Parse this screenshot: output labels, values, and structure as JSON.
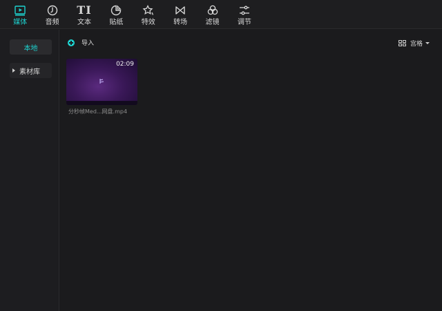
{
  "toolbar": {
    "tabs": [
      {
        "label": "媒体",
        "icon": "media-icon",
        "active": true
      },
      {
        "label": "音频",
        "icon": "audio-icon",
        "active": false
      },
      {
        "label": "文本",
        "icon": "text-icon",
        "active": false
      },
      {
        "label": "贴纸",
        "icon": "sticker-icon",
        "active": false
      },
      {
        "label": "特效",
        "icon": "effects-icon",
        "active": false
      },
      {
        "label": "转场",
        "icon": "transition-icon",
        "active": false
      },
      {
        "label": "滤镜",
        "icon": "filter-icon",
        "active": false
      },
      {
        "label": "调节",
        "icon": "adjust-icon",
        "active": false
      }
    ],
    "text_icon_glyph": "TI"
  },
  "sidebar": {
    "local": "本地",
    "library": "素材库"
  },
  "main": {
    "import_label": "导入",
    "view_label": "宫格"
  },
  "media_items": [
    {
      "duration": "02:09",
      "filename": "分秒帧Med...网盘.mp4"
    }
  ],
  "colors": {
    "accent": "#1dd3d0",
    "background": "#1b1b1d",
    "panel": "#1e1e20"
  }
}
